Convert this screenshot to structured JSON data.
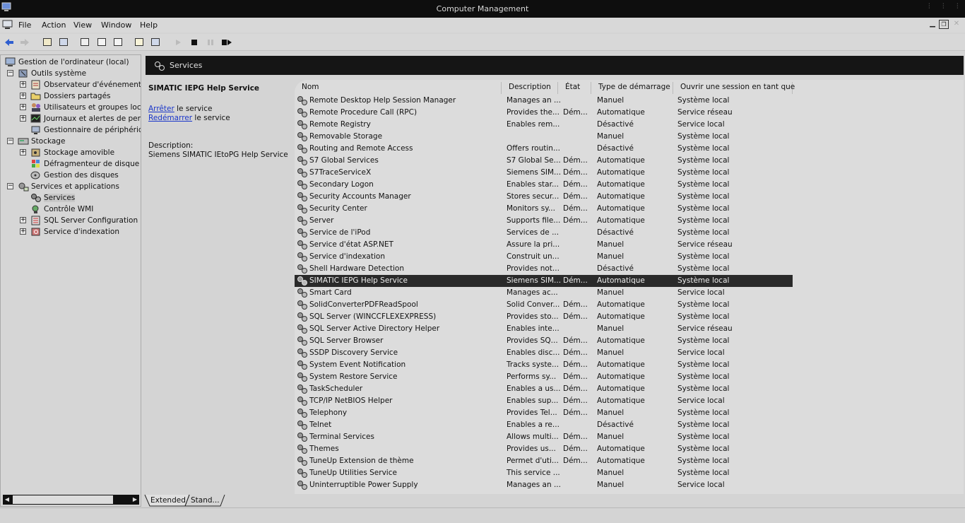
{
  "window": {
    "title": "Computer Management"
  },
  "menu": [
    "File",
    "Action",
    "View",
    "Window",
    "Help"
  ],
  "tree": {
    "items": [
      {
        "label": "Gestion de l'ordinateur (local)",
        "level": 0,
        "expander": ""
      },
      {
        "label": "Outils système",
        "level": 1,
        "expander": "-"
      },
      {
        "label": "Observateur d'événements",
        "level": 2,
        "expander": "+"
      },
      {
        "label": "Dossiers partagés",
        "level": 2,
        "expander": "+"
      },
      {
        "label": "Utilisateurs et groupes locaux",
        "level": 2,
        "expander": "+"
      },
      {
        "label": "Journaux et alertes de performance",
        "level": 2,
        "expander": "+"
      },
      {
        "label": "Gestionnaire de périphériques",
        "level": 2,
        "expander": ""
      },
      {
        "label": "Stockage",
        "level": 1,
        "expander": "-"
      },
      {
        "label": "Stockage amovible",
        "level": 2,
        "expander": "+"
      },
      {
        "label": "Défragmenteur de disque",
        "level": 2,
        "expander": ""
      },
      {
        "label": "Gestion des disques",
        "level": 2,
        "expander": ""
      },
      {
        "label": "Services et applications",
        "level": 1,
        "expander": "-"
      },
      {
        "label": "Services",
        "level": 2,
        "expander": ""
      },
      {
        "label": "Contrôle WMI",
        "level": 2,
        "expander": ""
      },
      {
        "label": "SQL Server Configuration Manager",
        "level": 2,
        "expander": "+"
      },
      {
        "label": "Service d'indexation",
        "level": 2,
        "expander": "+"
      }
    ]
  },
  "panel": {
    "header": "Services",
    "selected_service": "SIMATIC IEPG Help Service",
    "stop_link": "Arrêter",
    "stop_suffix": " le service",
    "restart_link": "Redémarrer",
    "restart_suffix": " le service",
    "description_label": "Description:",
    "description_text": "Siemens SIMATIC IEtoPG Help Service"
  },
  "table": {
    "columns": [
      "Nom",
      "Description",
      "État",
      "Type de démarrage",
      "Ouvrir une session en tant que"
    ],
    "rows": [
      [
        "Remote Desktop Help Session Manager",
        "Manages an ...",
        "",
        "Manuel",
        "Système local"
      ],
      [
        "Remote Procedure Call (RPC)",
        "Provides the...",
        "Dém...",
        "Automatique",
        "Service réseau"
      ],
      [
        "Remote Registry",
        "Enables rem...",
        "",
        "Désactivé",
        "Service local"
      ],
      [
        "Removable Storage",
        "",
        "",
        "Manuel",
        "Système local"
      ],
      [
        "Routing and Remote Access",
        "Offers routin...",
        "",
        "Désactivé",
        "Système local"
      ],
      [
        "S7 Global Services",
        "S7 Global Se...",
        "Dém...",
        "Automatique",
        "Système local"
      ],
      [
        "S7TraceServiceX",
        "Siemens SIM...",
        "Dém...",
        "Automatique",
        "Système local"
      ],
      [
        "Secondary Logon",
        "Enables star...",
        "Dém...",
        "Automatique",
        "Système local"
      ],
      [
        "Security Accounts Manager",
        "Stores secur...",
        "Dém...",
        "Automatique",
        "Système local"
      ],
      [
        "Security Center",
        "Monitors sy...",
        "Dém...",
        "Automatique",
        "Système local"
      ],
      [
        "Server",
        "Supports file...",
        "Dém...",
        "Automatique",
        "Système local"
      ],
      [
        "Service de l'iPod",
        "Services de ...",
        "",
        "Désactivé",
        "Système local"
      ],
      [
        "Service d'état ASP.NET",
        "Assure la pri...",
        "",
        "Manuel",
        "Service réseau"
      ],
      [
        "Service d'indexation",
        "Construit un...",
        "",
        "Manuel",
        "Système local"
      ],
      [
        "Shell Hardware Detection",
        "Provides not...",
        "",
        "Désactivé",
        "Système local"
      ],
      [
        "SIMATIC IEPG Help Service",
        "Siemens SIM...",
        "Dém...",
        "Automatique",
        "Système local"
      ],
      [
        "Smart Card",
        "Manages ac...",
        "",
        "Manuel",
        "Service local"
      ],
      [
        "SolidConverterPDFReadSpool",
        "Solid Conver...",
        "Dém...",
        "Automatique",
        "Système local"
      ],
      [
        "SQL Server (WINCCFLEXEXPRESS)",
        "Provides sto...",
        "Dém...",
        "Automatique",
        "Système local"
      ],
      [
        "SQL Server Active Directory Helper",
        "Enables inte...",
        "",
        "Manuel",
        "Service réseau"
      ],
      [
        "SQL Server Browser",
        "Provides SQ...",
        "Dém...",
        "Automatique",
        "Système local"
      ],
      [
        "SSDP Discovery Service",
        "Enables disc...",
        "Dém...",
        "Manuel",
        "Service local"
      ],
      [
        "System Event Notification",
        "Tracks syste...",
        "Dém...",
        "Automatique",
        "Système local"
      ],
      [
        "System Restore Service",
        "Performs sy...",
        "Dém...",
        "Automatique",
        "Système local"
      ],
      [
        "TaskScheduler",
        "Enables a us...",
        "Dém...",
        "Automatique",
        "Système local"
      ],
      [
        "TCP/IP NetBIOS Helper",
        "Enables sup...",
        "Dém...",
        "Automatique",
        "Service local"
      ],
      [
        "Telephony",
        "Provides Tel...",
        "Dém...",
        "Manuel",
        "Système local"
      ],
      [
        "Telnet",
        "Enables a re...",
        "",
        "Désactivé",
        "Système local"
      ],
      [
        "Terminal Services",
        "Allows multi...",
        "Dém...",
        "Manuel",
        "Système local"
      ],
      [
        "Themes",
        "Provides us...",
        "Dém...",
        "Automatique",
        "Système local"
      ],
      [
        "TuneUp Extension de thème",
        "Permet d'uti...",
        "Dém...",
        "Automatique",
        "Système local"
      ],
      [
        "TuneUp Utilities Service",
        "This service ...",
        "",
        "Manuel",
        "Système local"
      ],
      [
        "Uninterruptible Power Supply",
        "Manages an ...",
        "",
        "Manuel",
        "Service local"
      ]
    ],
    "selected_index": 15
  },
  "tabs": [
    "Extended",
    "Stand..."
  ]
}
